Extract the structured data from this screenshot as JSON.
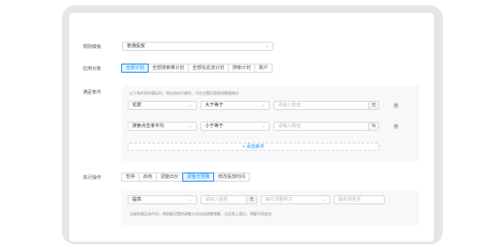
{
  "form": {
    "rule_template": {
      "label": "规则模板",
      "value": "普通投放"
    },
    "apply_object": {
      "label": "应用对象",
      "tabs": [
        "全部计划",
        "全部搜索推计划",
        "全部信息流计划",
        "搜索计划",
        "账户"
      ]
    },
    "condition": {
      "label": "满足条件",
      "hint": "以下条件同时满足时，将自动执行操作，可在设置页面修改数据统计",
      "rows": [
        {
          "metric": "花费",
          "operator": "大于等于",
          "placeholder": "请输入数值",
          "unit": "元",
          "delete": "删"
        },
        {
          "metric": "搜索点击率平均",
          "operator": "小于等于",
          "placeholder": "请输入数值",
          "unit": "%",
          "delete": "删"
        }
      ],
      "add_label": "+ 添加条件"
    },
    "action": {
      "label": "执行操作",
      "tabs": [
        "暂停",
        "启用",
        "调整出价",
        "调整日预算",
        "修改投放时间"
      ],
      "active_tab_index": 3,
      "adjust_type": "提高",
      "amount_placeholder": "请输入金额",
      "amount_unit": "元",
      "ratio_placeholder": "每日调整频次",
      "limit_placeholder": "最高调整至",
      "note": "当规则满足条件时，将根据设置的调整方式自动调整预算，当达到上限后，预算不再变化"
    }
  }
}
